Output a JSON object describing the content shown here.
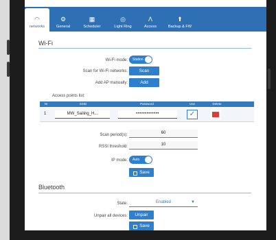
{
  "tabs": [
    {
      "icon": "wifi-icon",
      "glyph": "◠",
      "label": "networks",
      "active": true
    },
    {
      "icon": "gear-icon",
      "glyph": "⚙",
      "label": "General"
    },
    {
      "icon": "calendar-icon",
      "glyph": "▦",
      "label": "Scheduler"
    },
    {
      "icon": "ring-light-icon",
      "glyph": "◎",
      "label": "Light Ring"
    },
    {
      "icon": "access-icon",
      "glyph": "Ʌ",
      "label": "Access"
    },
    {
      "icon": "backup-icon",
      "glyph": "⬆",
      "label": "Backup & FW"
    }
  ],
  "wifi": {
    "title": "Wi-Fi",
    "mode_label": "Wi-Fi mode:",
    "mode_value": "Station",
    "scan_label": "Scan for Wi-Fi networks:",
    "scan_button": "Scan",
    "add_label": "Add AP manually:",
    "add_button": "Add",
    "ap_list_label": "Access points list:",
    "table": {
      "headers": [
        "Nr",
        "SSID",
        "Password",
        "Use",
        "Delete"
      ],
      "rows": [
        {
          "nr": "1",
          "ssid": "MW_Sailing_H...",
          "password": "•••••••••••••",
          "use": true
        }
      ]
    },
    "scan_period_label": "Scan period(s):",
    "scan_period_value": "60",
    "rssi_label": "RSSI threshold:",
    "rssi_value": "10",
    "ip_mode_label": "IP mode:",
    "ip_mode_value": "Auto",
    "save_button": "Save"
  },
  "bluetooth": {
    "title": "Bluetooth",
    "state_label": "State:",
    "state_value": "Enabled",
    "unpair_label": "Unpair all devices:",
    "unpair_button": "Unpair",
    "save_button": "Save"
  },
  "colors": {
    "accent": "#2f7fcf",
    "tabbar": "#2f6fb3",
    "delete": "#e03a3a"
  }
}
